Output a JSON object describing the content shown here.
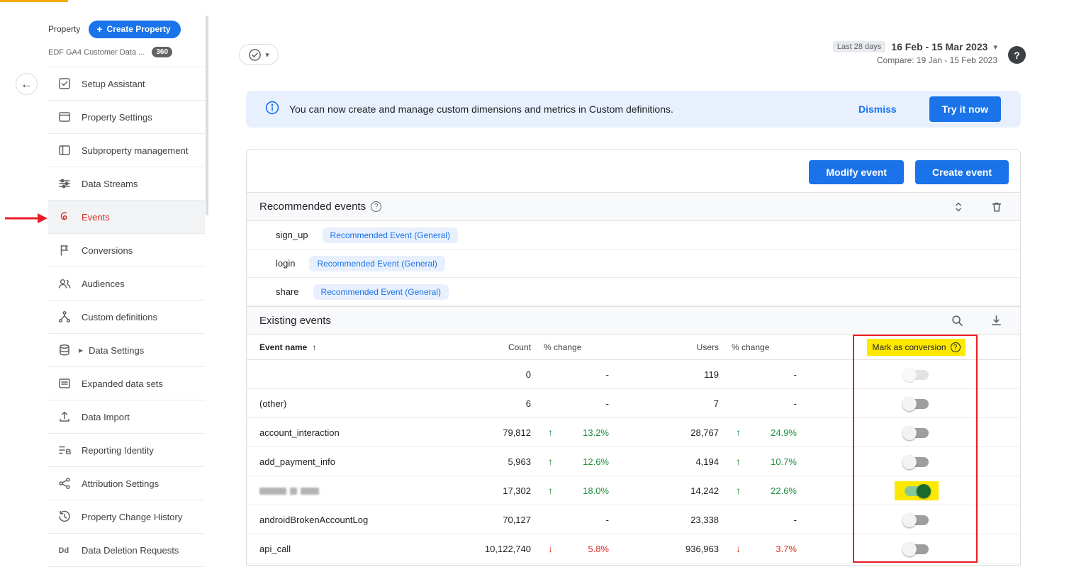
{
  "colors": {
    "accent_blue": "#1a73e8",
    "positive_green": "#1e8e3e",
    "negative_red": "#d93025",
    "highlight_yellow": "#fde800",
    "annotation_red": "#ec1c24"
  },
  "sidebar": {
    "section_label": "Property",
    "create_button_label": "Create Property",
    "property_name": "EDF GA4 Customer Data ...",
    "badge": "360",
    "items": [
      {
        "label": "Setup Assistant",
        "icon": "setup-assistant-icon"
      },
      {
        "label": "Property Settings",
        "icon": "property-settings-icon"
      },
      {
        "label": "Subproperty management",
        "icon": "subproperty-icon"
      },
      {
        "label": "Data Streams",
        "icon": "data-streams-icon"
      },
      {
        "label": "Events",
        "icon": "events-icon",
        "active": true
      },
      {
        "label": "Conversions",
        "icon": "conversions-icon"
      },
      {
        "label": "Audiences",
        "icon": "audiences-icon"
      },
      {
        "label": "Custom definitions",
        "icon": "custom-definitions-icon"
      },
      {
        "label": "Data Settings",
        "icon": "data-settings-icon",
        "expandable": true
      },
      {
        "label": "Expanded data sets",
        "icon": "expanded-data-sets-icon"
      },
      {
        "label": "Data Import",
        "icon": "data-import-icon"
      },
      {
        "label": "Reporting Identity",
        "icon": "reporting-identity-icon"
      },
      {
        "label": "Attribution Settings",
        "icon": "attribution-settings-icon"
      },
      {
        "label": "Property Change History",
        "icon": "history-icon"
      },
      {
        "label": "Data Deletion Requests",
        "icon": "data-deletion-icon"
      }
    ]
  },
  "topbar": {
    "date_preset": "Last 28 days",
    "date_range": "16 Feb - 15 Mar 2023",
    "compare_text": "Compare: 19 Jan - 15 Feb 2023",
    "help_label": "?"
  },
  "banner": {
    "message": "You can now create and manage custom dimensions and metrics in Custom definitions.",
    "dismiss_label": "Dismiss",
    "cta_label": "Try it now"
  },
  "toolbar": {
    "modify_event_label": "Modify event",
    "create_event_label": "Create event"
  },
  "recommended": {
    "title": "Recommended events",
    "rows": [
      {
        "name": "sign_up",
        "chip": "Recommended Event (General)"
      },
      {
        "name": "login",
        "chip": "Recommended Event (General)"
      },
      {
        "name": "share",
        "chip": "Recommended Event (General)"
      }
    ]
  },
  "existing": {
    "title": "Existing events",
    "columns": {
      "event_name": "Event name",
      "count": "Count",
      "count_change": "% change",
      "users": "Users",
      "users_change": "% change",
      "mark_as_conversion": "Mark as conversion"
    },
    "rows": [
      {
        "name": "",
        "count": "0",
        "count_change": "-",
        "count_trend": "none",
        "users": "119",
        "users_change": "-",
        "users_trend": "none",
        "conversion": false
      },
      {
        "name": "(other)",
        "count": "6",
        "count_change": "-",
        "count_trend": "none",
        "users": "7",
        "users_change": "-",
        "users_trend": "none",
        "conversion": false
      },
      {
        "name": "account_interaction",
        "count": "79,812",
        "count_change": "13.2%",
        "count_trend": "up",
        "users": "28,767",
        "users_change": "24.9%",
        "users_trend": "up",
        "conversion": false
      },
      {
        "name": "add_payment_info",
        "count": "5,963",
        "count_change": "12.6%",
        "count_trend": "up",
        "users": "4,194",
        "users_change": "10.7%",
        "users_trend": "up",
        "conversion": false
      },
      {
        "name": "",
        "redacted": true,
        "count": "17,302",
        "count_change": "18.0%",
        "count_trend": "up",
        "users": "14,242",
        "users_change": "22.6%",
        "users_trend": "up",
        "conversion": true
      },
      {
        "name": "androidBrokenAccountLog",
        "count": "70,127",
        "count_change": "-",
        "count_trend": "none",
        "users": "23,338",
        "users_change": "-",
        "users_trend": "none",
        "conversion": false
      },
      {
        "name": "api_call",
        "count": "10,122,740",
        "count_change": "5.8%",
        "count_trend": "down",
        "users": "936,963",
        "users_change": "3.7%",
        "users_trend": "down",
        "conversion": false
      }
    ]
  }
}
